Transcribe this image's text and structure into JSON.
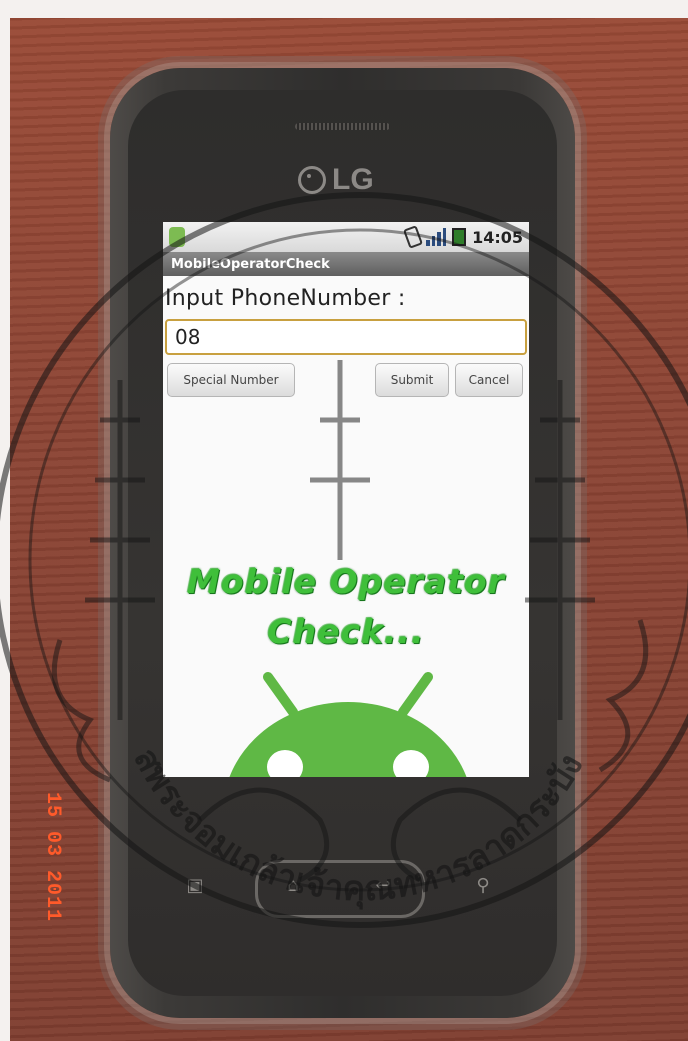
{
  "phone": {
    "brand": "LG",
    "status_bar": {
      "time": "14:05"
    },
    "app": {
      "title": "MobileOperatorCheck",
      "prompt": "Input PhoneNumber :",
      "input_value": "08",
      "buttons": {
        "special_number": "Special Number",
        "submit": "Submit",
        "cancel": "Cancel"
      },
      "splash_line1": "Mobile Operator",
      "splash_line2": "Check..."
    }
  },
  "date_stamp": "15 03 2011",
  "seal_text": "สพระจอมเกล้าเจ้าคุณทหารลาดกระบัง",
  "colors": {
    "wood": "#8c4434",
    "screen_bg": "#fafafa",
    "android_green": "#5fb845",
    "splash_green": "#3fbf3a",
    "date_stamp": "#ff5a2a"
  }
}
